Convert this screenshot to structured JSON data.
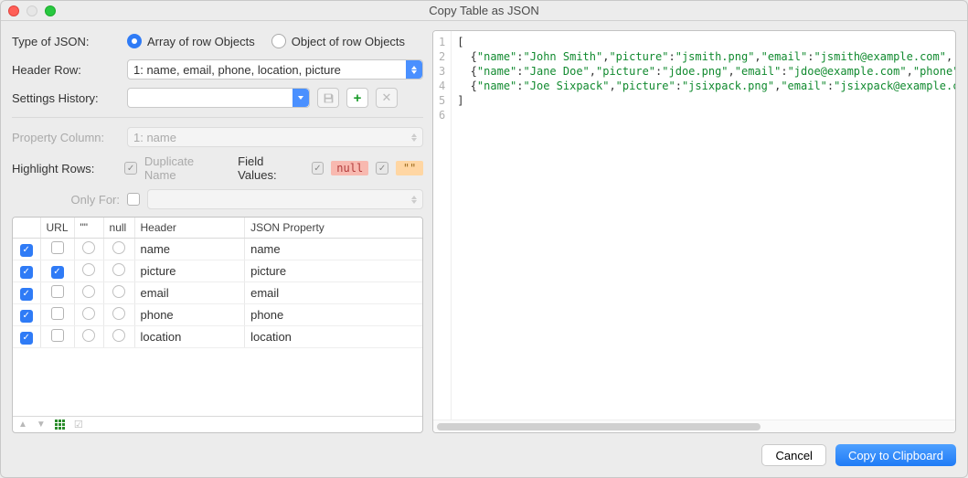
{
  "window": {
    "title": "Copy Table as JSON"
  },
  "labels": {
    "type": "Type of JSON:",
    "headerRow": "Header Row:",
    "settingsHistory": "Settings History:",
    "propertyColumn": "Property Column:",
    "highlightRows": "Highlight Rows:",
    "duplicateName": "Duplicate Name",
    "fieldValues": "Field Values:",
    "onlyFor": "Only For:"
  },
  "radios": {
    "arrayRow": "Array of row Objects",
    "objectRow": "Object of row Objects"
  },
  "selects": {
    "headerRow": "1: name, email, phone, location, picture",
    "settingsHistory": "",
    "propertyColumn": "1: name",
    "onlyFor": ""
  },
  "badges": {
    "null": "null",
    "empty": "\"\""
  },
  "table": {
    "headers": {
      "col1": "",
      "url": "URL",
      "quote": "\"\"",
      "null": "null",
      "header": "Header",
      "json": "JSON Property"
    },
    "rows": [
      {
        "checked": true,
        "url": false,
        "header": "name",
        "json": "name"
      },
      {
        "checked": true,
        "url": true,
        "header": "picture",
        "json": "picture"
      },
      {
        "checked": true,
        "url": false,
        "header": "email",
        "json": "email"
      },
      {
        "checked": true,
        "url": false,
        "header": "phone",
        "json": "phone"
      },
      {
        "checked": true,
        "url": false,
        "header": "location",
        "json": "location"
      }
    ]
  },
  "preview": {
    "lines": [
      [
        {
          "t": "[",
          "c": "p"
        }
      ],
      [
        {
          "t": "  {",
          "c": "p"
        },
        {
          "t": "\"name\"",
          "c": "k"
        },
        {
          "t": ":",
          "c": "p"
        },
        {
          "t": "\"John Smith\"",
          "c": "k"
        },
        {
          "t": ",",
          "c": "p"
        },
        {
          "t": "\"picture\"",
          "c": "k"
        },
        {
          "t": ":",
          "c": "p"
        },
        {
          "t": "\"jsmith.png\"",
          "c": "k"
        },
        {
          "t": ",",
          "c": "p"
        },
        {
          "t": "\"email\"",
          "c": "k"
        },
        {
          "t": ":",
          "c": "p"
        },
        {
          "t": "\"jsmith@example.com\"",
          "c": "k"
        },
        {
          "t": ",",
          "c": "p"
        }
      ],
      [
        {
          "t": "  {",
          "c": "p"
        },
        {
          "t": "\"name\"",
          "c": "k"
        },
        {
          "t": ":",
          "c": "p"
        },
        {
          "t": "\"Jane Doe\"",
          "c": "k"
        },
        {
          "t": ",",
          "c": "p"
        },
        {
          "t": "\"picture\"",
          "c": "k"
        },
        {
          "t": ":",
          "c": "p"
        },
        {
          "t": "\"jdoe.png\"",
          "c": "k"
        },
        {
          "t": ",",
          "c": "p"
        },
        {
          "t": "\"email\"",
          "c": "k"
        },
        {
          "t": ":",
          "c": "p"
        },
        {
          "t": "\"jdoe@example.com\"",
          "c": "k"
        },
        {
          "t": ",",
          "c": "p"
        },
        {
          "t": "\"phone\"",
          "c": "k"
        }
      ],
      [
        {
          "t": "  {",
          "c": "p"
        },
        {
          "t": "\"name\"",
          "c": "k"
        },
        {
          "t": ":",
          "c": "p"
        },
        {
          "t": "\"Joe Sixpack\"",
          "c": "k"
        },
        {
          "t": ",",
          "c": "p"
        },
        {
          "t": "\"picture\"",
          "c": "k"
        },
        {
          "t": ":",
          "c": "p"
        },
        {
          "t": "\"jsixpack.png\"",
          "c": "k"
        },
        {
          "t": ",",
          "c": "p"
        },
        {
          "t": "\"email\"",
          "c": "k"
        },
        {
          "t": ":",
          "c": "p"
        },
        {
          "t": "\"jsixpack@example.c",
          "c": "k"
        }
      ],
      [
        {
          "t": "]",
          "c": "p"
        }
      ],
      [
        {
          "t": "",
          "c": "p"
        }
      ]
    ]
  },
  "buttons": {
    "cancel": "Cancel",
    "copy": "Copy to Clipboard"
  }
}
